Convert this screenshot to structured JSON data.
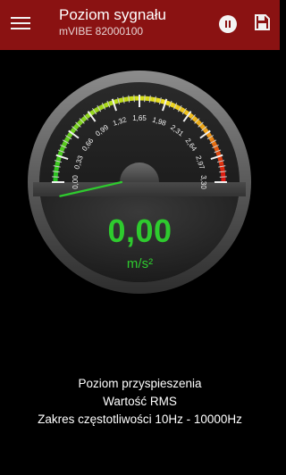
{
  "appbar": {
    "title": "Poziom sygnału",
    "subtitle": "mVIBE 82000100"
  },
  "icons": {
    "menu": "hamburger-menu-icon",
    "pause": "pause-circle-icon",
    "save": "save-floppy-icon"
  },
  "gauge": {
    "value": 0.0,
    "display_value": "0,00",
    "unit": "m/s²",
    "min": 0,
    "max": 3.3,
    "ticks": [
      "0,00",
      "0,33",
      "0,66",
      "0,99",
      "1,32",
      "1,65",
      "1,98",
      "2,31",
      "2,64",
      "2,97",
      "3,30"
    ],
    "colors": {
      "accent": "#8a1212",
      "value": "#2ecb2e",
      "needle": "#2ecb2e"
    }
  },
  "info": {
    "line1": "Poziom przyspieszenia",
    "line2": "Wartość RMS",
    "line3": "Zakres częstotliwości 10Hz - 10000Hz"
  }
}
